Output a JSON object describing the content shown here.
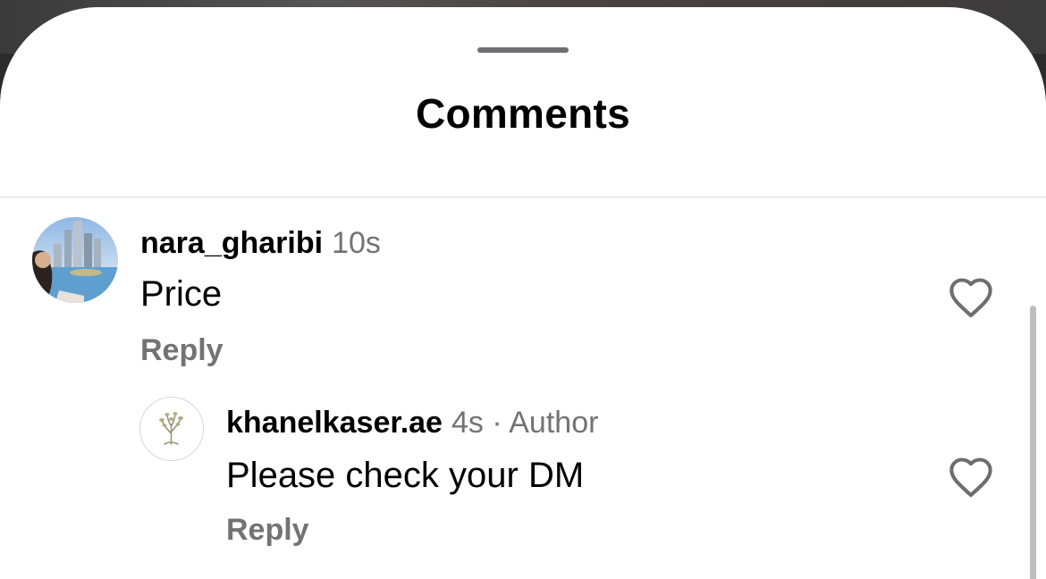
{
  "header": {
    "title": "Comments"
  },
  "comments": [
    {
      "username": "nara_gharibi",
      "time": "10s",
      "text": "Price",
      "reply_label": "Reply",
      "avatar": "city-skyline-photo"
    }
  ],
  "replies": [
    {
      "username": "khanelkaser.ae",
      "time": "4s",
      "separator": "·",
      "tag": "Author",
      "text": "Please check your DM",
      "reply_label": "Reply",
      "avatar": "tree-logo"
    }
  ],
  "icons": {
    "like": "heart-outline-icon"
  },
  "colors": {
    "sheet_bg": "#ffffff",
    "primary_text": "#000000",
    "secondary_text": "#737373",
    "divider": "#dcdcdc"
  }
}
